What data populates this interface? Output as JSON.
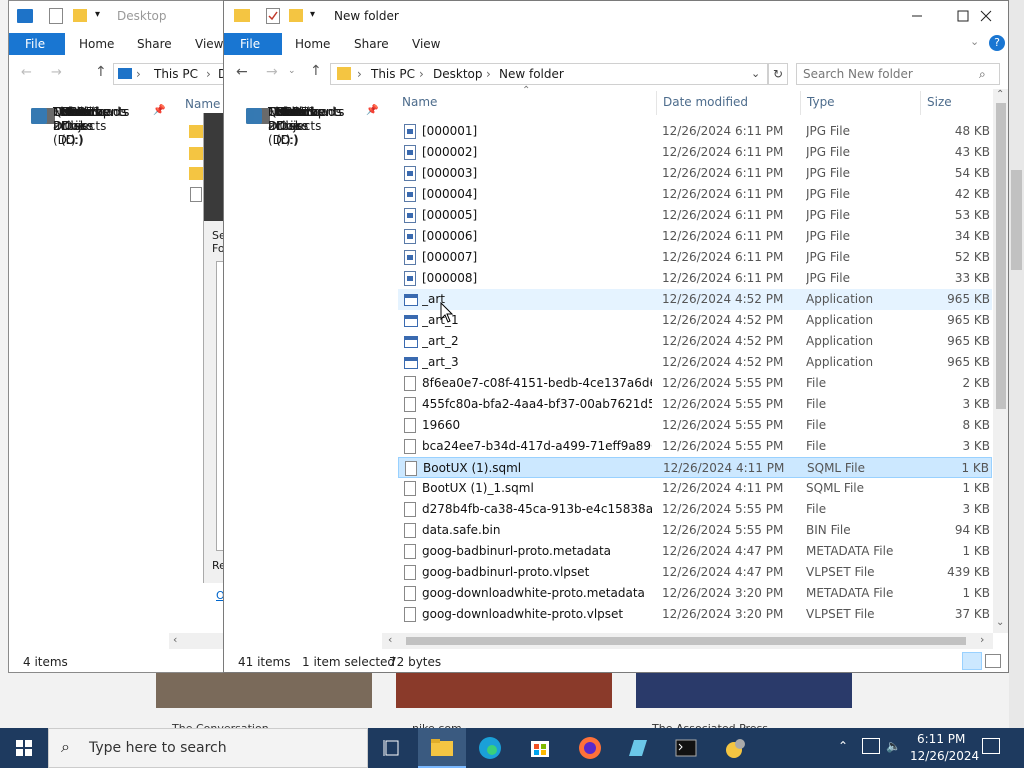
{
  "background": {
    "captions": [
      "The Conversation",
      "nike.com",
      "The Associated Press"
    ]
  },
  "back_window": {
    "title": "Desktop",
    "ribbon": {
      "file": "File",
      "home": "Home",
      "share": "Share",
      "view": "View"
    },
    "breadcrumb": [
      "This PC",
      "D"
    ],
    "column_name": "Name",
    "status": "4 items",
    "nav": [
      {
        "label": "Quick access",
        "icon": "star-icon"
      },
      {
        "label": "Desktop",
        "icon": "desktop-icon",
        "pinned": true
      },
      {
        "label": "Downloads",
        "icon": "download-icon",
        "pinned": true
      },
      {
        "label": "Documents",
        "icon": "documents-icon",
        "pinned": true
      },
      {
        "label": "Pictures",
        "icon": "pictures-icon",
        "pinned": true
      },
      {
        "label": "Music",
        "icon": "music-icon"
      },
      {
        "label": "Videos",
        "icon": "videos-icon"
      },
      {
        "label": "OneDrive",
        "icon": "cloud-icon"
      },
      {
        "label": "This PC",
        "icon": "computer-icon"
      },
      {
        "label": "3D Objects",
        "icon": "cube-icon"
      },
      {
        "label": "Desktop",
        "icon": "desktop-icon",
        "selected": true
      },
      {
        "label": "Documents",
        "icon": "documents-icon"
      },
      {
        "label": "Downloads",
        "icon": "download-icon"
      },
      {
        "label": "Music",
        "icon": "music-icon"
      },
      {
        "label": "Pictures",
        "icon": "pictures-icon"
      },
      {
        "label": "Videos",
        "icon": "videos-icon"
      },
      {
        "label": "Local Disk (C:)",
        "icon": "disk-icon"
      },
      {
        "label": "USB Drive (D:)",
        "icon": "usb-icon"
      },
      {
        "label": "USB Drive (D:)",
        "icon": "usb-icon"
      },
      {
        "label": "FHAAFS 2.0",
        "icon": "drive-icon"
      },
      {
        "label": "Network",
        "icon": "network-icon"
      }
    ],
    "dialog_fragments": [
      "Se",
      "Fo",
      "Re",
      "O"
    ]
  },
  "front_window": {
    "title": "New folder",
    "ribbon": {
      "file": "File",
      "home": "Home",
      "share": "Share",
      "view": "View"
    },
    "breadcrumb": [
      "This PC",
      "Desktop",
      "New folder"
    ],
    "search_placeholder": "Search New folder",
    "columns": {
      "name": "Name",
      "date": "Date modified",
      "type": "Type",
      "size": "Size"
    },
    "nav": [
      {
        "label": "Quick access",
        "icon": "star-icon"
      },
      {
        "label": "Desktop",
        "icon": "desktop-icon",
        "pinned": true
      },
      {
        "label": "Downloads",
        "icon": "download-icon",
        "pinned": true
      },
      {
        "label": "Documents",
        "icon": "documents-icon",
        "pinned": true
      },
      {
        "label": "Pictures",
        "icon": "pictures-icon",
        "pinned": true
      },
      {
        "label": "Music",
        "icon": "music-icon"
      },
      {
        "label": "Videos",
        "icon": "videos-icon"
      },
      {
        "label": "OneDrive",
        "icon": "cloud-icon"
      },
      {
        "label": "This PC",
        "icon": "computer-icon"
      },
      {
        "label": "3D Objects",
        "icon": "cube-icon"
      },
      {
        "label": "Desktop",
        "icon": "desktop-icon",
        "selected": true
      },
      {
        "label": "Documents",
        "icon": "documents-icon"
      },
      {
        "label": "Downloads",
        "icon": "download-icon"
      },
      {
        "label": "Music",
        "icon": "music-icon"
      },
      {
        "label": "Pictures",
        "icon": "pictures-icon"
      },
      {
        "label": "Videos",
        "icon": "videos-icon"
      },
      {
        "label": "Local Disk (C:)",
        "icon": "disk-icon"
      },
      {
        "label": "USB Drive (D:)",
        "icon": "usb-icon"
      },
      {
        "label": "USB Drive (D:)",
        "icon": "usb-icon"
      },
      {
        "label": "FHAAFS 2.0",
        "icon": "drive-icon"
      },
      {
        "label": "Network",
        "icon": "network-icon"
      }
    ],
    "files": [
      {
        "name": "[000001]",
        "date": "12/26/2024 6:11 PM",
        "type": "JPG File",
        "size": "48 KB",
        "icon": "image-file-icon"
      },
      {
        "name": "[000002]",
        "date": "12/26/2024 6:11 PM",
        "type": "JPG File",
        "size": "43 KB",
        "icon": "image-file-icon"
      },
      {
        "name": "[000003]",
        "date": "12/26/2024 6:11 PM",
        "type": "JPG File",
        "size": "54 KB",
        "icon": "image-file-icon"
      },
      {
        "name": "[000004]",
        "date": "12/26/2024 6:11 PM",
        "type": "JPG File",
        "size": "42 KB",
        "icon": "image-file-icon"
      },
      {
        "name": "[000005]",
        "date": "12/26/2024 6:11 PM",
        "type": "JPG File",
        "size": "53 KB",
        "icon": "image-file-icon"
      },
      {
        "name": "[000006]",
        "date": "12/26/2024 6:11 PM",
        "type": "JPG File",
        "size": "34 KB",
        "icon": "image-file-icon"
      },
      {
        "name": "[000007]",
        "date": "12/26/2024 6:11 PM",
        "type": "JPG File",
        "size": "52 KB",
        "icon": "image-file-icon"
      },
      {
        "name": "[000008]",
        "date": "12/26/2024 6:11 PM",
        "type": "JPG File",
        "size": "33 KB",
        "icon": "image-file-icon"
      },
      {
        "name": "_art",
        "date": "12/26/2024 4:52 PM",
        "type": "Application",
        "size": "965 KB",
        "icon": "application-icon",
        "hover": true
      },
      {
        "name": "_art_1",
        "date": "12/26/2024 4:52 PM",
        "type": "Application",
        "size": "965 KB",
        "icon": "application-icon"
      },
      {
        "name": "_art_2",
        "date": "12/26/2024 4:52 PM",
        "type": "Application",
        "size": "965 KB",
        "icon": "application-icon"
      },
      {
        "name": "_art_3",
        "date": "12/26/2024 4:52 PM",
        "type": "Application",
        "size": "965 KB",
        "icon": "application-icon"
      },
      {
        "name": "8f6ea0e7-c08f-4151-bedb-4ce137a6d683",
        "date": "12/26/2024 5:55 PM",
        "type": "File",
        "size": "2 KB",
        "icon": "blank-file-icon"
      },
      {
        "name": "455fc80a-bfa2-4aa4-bf37-00ab7621d59a",
        "date": "12/26/2024 5:55 PM",
        "type": "File",
        "size": "3 KB",
        "icon": "blank-file-icon"
      },
      {
        "name": "19660",
        "date": "12/26/2024 5:55 PM",
        "type": "File",
        "size": "8 KB",
        "icon": "blank-file-icon"
      },
      {
        "name": "bca24ee7-b34d-417d-a499-71eff9a896ec",
        "date": "12/26/2024 5:55 PM",
        "type": "File",
        "size": "3 KB",
        "icon": "blank-file-icon"
      },
      {
        "name": "BootUX (1).sqml",
        "date": "12/26/2024 4:11 PM",
        "type": "SQML File",
        "size": "1 KB",
        "icon": "blank-file-icon",
        "selected": true
      },
      {
        "name": "BootUX (1)_1.sqml",
        "date": "12/26/2024 4:11 PM",
        "type": "SQML File",
        "size": "1 KB",
        "icon": "blank-file-icon"
      },
      {
        "name": "d278b4fb-ca38-45ca-913b-e4c15838abd7",
        "date": "12/26/2024 5:55 PM",
        "type": "File",
        "size": "3 KB",
        "icon": "blank-file-icon"
      },
      {
        "name": "data.safe.bin",
        "date": "12/26/2024 5:55 PM",
        "type": "BIN File",
        "size": "94 KB",
        "icon": "blank-file-icon"
      },
      {
        "name": "goog-badbinurl-proto.metadata",
        "date": "12/26/2024 4:47 PM",
        "type": "METADATA File",
        "size": "1 KB",
        "icon": "blank-file-icon"
      },
      {
        "name": "goog-badbinurl-proto.vlpset",
        "date": "12/26/2024 4:47 PM",
        "type": "VLPSET File",
        "size": "439 KB",
        "icon": "blank-file-icon"
      },
      {
        "name": "goog-downloadwhite-proto.metadata",
        "date": "12/26/2024 3:20 PM",
        "type": "METADATA File",
        "size": "1 KB",
        "icon": "blank-file-icon"
      },
      {
        "name": "goog-downloadwhite-proto.vlpset",
        "date": "12/26/2024 3:20 PM",
        "type": "VLPSET File",
        "size": "37 KB",
        "icon": "blank-file-icon"
      }
    ],
    "status": {
      "items": "41 items",
      "selected": "1 item selected",
      "size": "72 bytes"
    }
  },
  "taskbar": {
    "search_placeholder": "Type here to search",
    "time": "6:11 PM",
    "date": "12/26/2024",
    "apps": [
      "task-view-icon",
      "file-explorer-icon",
      "edge-icon",
      "store-icon",
      "firefox-icon",
      "notepad-icon",
      "terminal-icon",
      "app-icon"
    ]
  },
  "colors": {
    "accent": "#1976d2",
    "selection": "#cce8ff",
    "taskbar": "#1e3a5f"
  }
}
